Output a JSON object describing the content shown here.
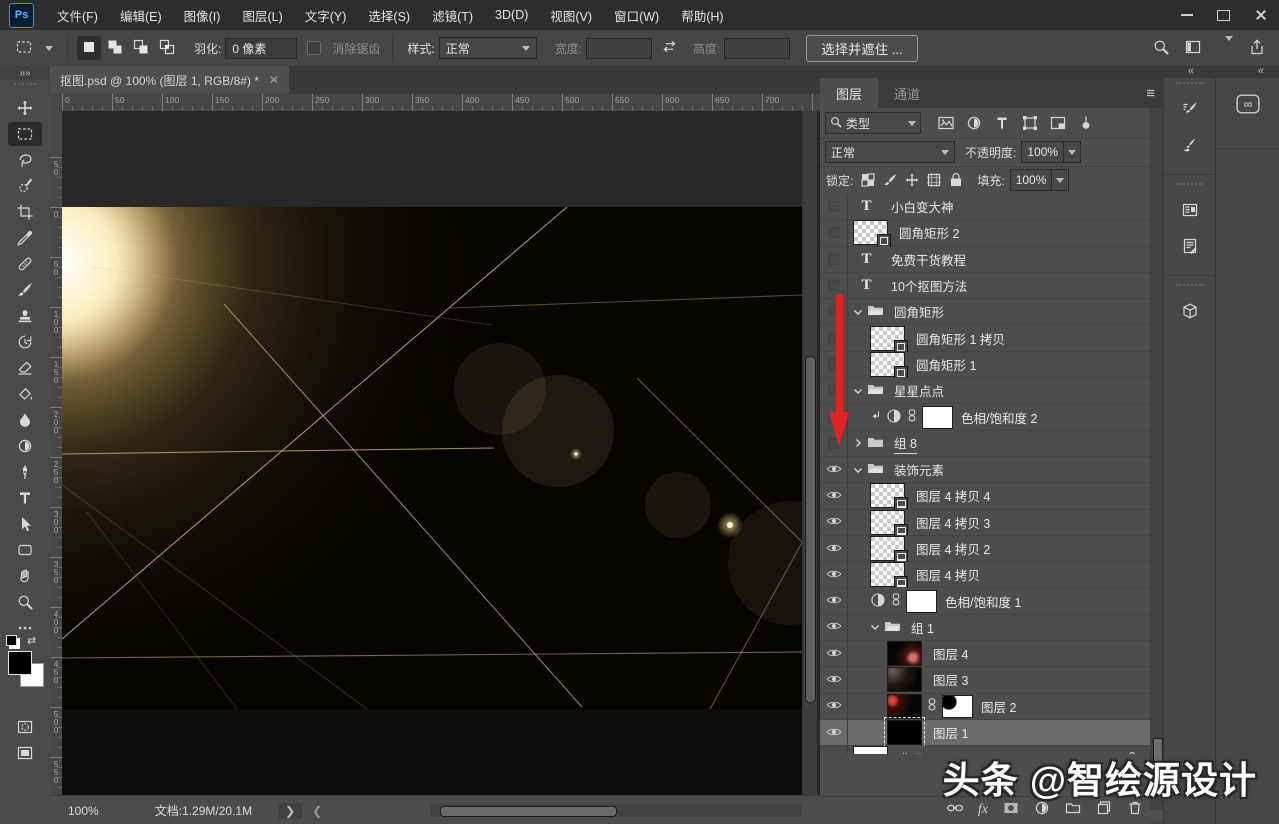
{
  "menu_bar": {
    "logo": "Ps",
    "items": [
      "文件(F)",
      "编辑(E)",
      "图像(I)",
      "图层(L)",
      "文字(Y)",
      "选择(S)",
      "滤镜(T)",
      "3D(D)",
      "视图(V)",
      "窗口(W)",
      "帮助(H)"
    ],
    "window_buttons": [
      "minimize",
      "maximize",
      "close"
    ]
  },
  "options_bar": {
    "tool_icon": "rectangular-marquee",
    "modes": [
      "new-selection",
      "add-to-selection",
      "subtract-from-selection",
      "intersect-with-selection"
    ],
    "feather_label": "羽化:",
    "feather_value": "0 像素",
    "antialias_label": "消除锯齿",
    "style_label": "样式:",
    "style_value": "正常",
    "width_label": "宽度:",
    "width_value": "",
    "height_label": "高度:",
    "height_value": "",
    "select_and_mask": "选择并遮住 ...",
    "right_icons": [
      "search",
      "workspace-switcher",
      "chevron-down",
      "share"
    ]
  },
  "toolbar": {
    "tools": [
      {
        "name": "move"
      },
      {
        "name": "rectangular-marquee",
        "selected": true
      },
      {
        "name": "lasso"
      },
      {
        "name": "quick-selection"
      },
      {
        "name": "crop"
      },
      {
        "name": "eyedropper"
      },
      {
        "name": "spot-healing"
      },
      {
        "name": "brush"
      },
      {
        "name": "clone-stamp"
      },
      {
        "name": "history-brush"
      },
      {
        "name": "eraser"
      },
      {
        "name": "gradient"
      },
      {
        "name": "blur"
      },
      {
        "name": "dodge"
      },
      {
        "name": "pen"
      },
      {
        "name": "type"
      },
      {
        "name": "path-selection"
      },
      {
        "name": "rectangle"
      },
      {
        "name": "hand"
      },
      {
        "name": "zoom"
      },
      {
        "name": "edit-toolbar"
      }
    ],
    "foreground_color": "#000000",
    "background_color": "#ffffff",
    "extra": [
      "quick-mask",
      "screen-mode"
    ]
  },
  "document": {
    "tab_title": "抠图.psd @ 100% (图层 1, RGB/8#) *",
    "ruler_h": [
      "0",
      "50",
      "100",
      "150",
      "200",
      "250",
      "300",
      "350",
      "400",
      "450",
      "500",
      "550",
      "600",
      "650",
      "700"
    ],
    "ruler_v": [
      "50",
      "0",
      "50",
      "100",
      "150",
      "200",
      "250",
      "300",
      "350",
      "400",
      "450",
      "500",
      "550"
    ],
    "zoom_level": "100%",
    "doc_info": "文档:1.29M/20.1M"
  },
  "layers_panel": {
    "tabs": [
      {
        "label": "图层",
        "active": true
      },
      {
        "label": "通道",
        "active": false
      }
    ],
    "filter_label": "类型",
    "filter_icons": [
      "filter-pixel",
      "filter-adjustment",
      "filter-type",
      "filter-shape",
      "filter-smart",
      "filter-toggle"
    ],
    "blend_mode": "正常",
    "opacity_label": "不透明度:",
    "opacity_value": "100%",
    "lock_label": "锁定:",
    "lock_icons": [
      "lock-transparency",
      "lock-paint",
      "lock-position",
      "lock-artboard",
      "lock-all"
    ],
    "fill_label": "填充:",
    "fill_value": "100%",
    "layers": [
      {
        "name": "小白变大神",
        "kind": "text",
        "eye": false,
        "indent": 0
      },
      {
        "name": "圆角矩形 2",
        "kind": "shape",
        "eye": false,
        "indent": 0
      },
      {
        "name": "免费干货教程",
        "kind": "text",
        "eye": false,
        "indent": 0
      },
      {
        "name": "10个抠图方法",
        "kind": "text",
        "eye": false,
        "indent": 0
      },
      {
        "name": "圆角矩形",
        "kind": "group",
        "open": true,
        "eye": false,
        "indent": 0
      },
      {
        "name": "圆角矩形 1 拷贝",
        "kind": "shape",
        "eye": false,
        "indent": 1
      },
      {
        "name": "圆角矩形 1",
        "kind": "shape",
        "eye": false,
        "indent": 1
      },
      {
        "name": "星星点点",
        "kind": "group",
        "open": true,
        "eye": false,
        "indent": 0
      },
      {
        "name": "色相/饱和度 2",
        "kind": "adjust",
        "clip": true,
        "eye": false,
        "indent": 1
      },
      {
        "name": "组 8",
        "kind": "group",
        "open": false,
        "eye": false,
        "indent": 0,
        "underline": true
      },
      {
        "name": "装饰元素",
        "kind": "group",
        "open": true,
        "eye": true,
        "indent": 0
      },
      {
        "name": "图层 4 拷贝 4",
        "kind": "smart",
        "eye": true,
        "indent": 1
      },
      {
        "name": "图层 4 拷贝 3",
        "kind": "smart",
        "eye": true,
        "indent": 1
      },
      {
        "name": "图层 4 拷贝 2",
        "kind": "smart",
        "eye": true,
        "indent": 1
      },
      {
        "name": "图层 4 拷贝",
        "kind": "smart",
        "eye": true,
        "indent": 1
      },
      {
        "name": "色相/饱和度 1",
        "kind": "adjust",
        "clip": false,
        "eye": true,
        "indent": 1
      },
      {
        "name": "组 1",
        "kind": "group",
        "open": true,
        "eye": true,
        "indent": 1
      },
      {
        "name": "图层 4",
        "kind": "pixel",
        "thumb": "blk-red-br",
        "eye": true,
        "indent": 2
      },
      {
        "name": "图层 3",
        "kind": "pixel",
        "thumb": "dark-glow",
        "eye": true,
        "indent": 2
      },
      {
        "name": "图层 2",
        "kind": "pixel",
        "thumb": "blk-red-tl",
        "mask": "corner",
        "linked": true,
        "eye": true,
        "indent": 2
      },
      {
        "name": "图层 1",
        "kind": "pixel",
        "thumb": "black",
        "selected": true,
        "eye": true,
        "indent": 2
      },
      {
        "name": "背景",
        "kind": "background",
        "eye": true,
        "indent": 0,
        "locked": true
      }
    ],
    "bottom_icons": [
      "link-layers",
      "layer-style",
      "add-layer-mask",
      "new-adjustment-layer",
      "new-group",
      "new-layer",
      "delete-layer"
    ]
  },
  "right_dock": {
    "panels": [
      "brush-settings",
      "brushes",
      "character",
      "paragraph",
      "3d"
    ],
    "cloud_icon": "creative-cloud"
  },
  "status_bar": {
    "zoom": "100%",
    "doc_info": "文档:1.29M/20.1M"
  },
  "watermark": "头条 @智绘源设计",
  "annotation": {
    "type": "red-arrow",
    "color": "#e42320"
  },
  "colors": {
    "accent_blue": "#31a8ff",
    "gold": "#c9a96a",
    "panel": "#4d4d4d",
    "pasteboard": "#282828",
    "selected_row": "#6b6b6b"
  }
}
